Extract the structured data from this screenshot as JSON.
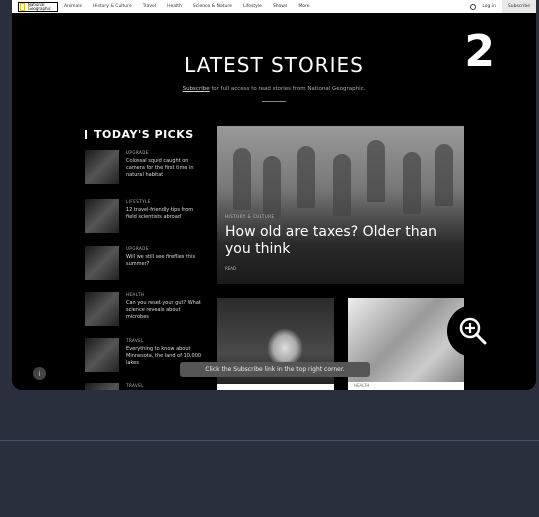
{
  "nav": {
    "logo_text": "National Geographic",
    "links": [
      "Animals",
      "History & Culture",
      "Travel",
      "Health",
      "Science & Nature",
      "Lifestyle",
      "Shows",
      "More"
    ],
    "login": "Log in",
    "subscribe": "Subscribe"
  },
  "step_number": "2",
  "section": {
    "title": "LATEST STORIES",
    "subtitle_link": "Subscribe",
    "subtitle_rest": " for full access to read stories from National Geographic."
  },
  "picks": {
    "title": "TODAY'S PICKS",
    "items": [
      {
        "category": "UPGRADE",
        "title": "Colossal squid caught on camera for the first time in natural habitat"
      },
      {
        "category": "LIFESTYLE",
        "title": "12 travel-friendly tips from field scientists abroad"
      },
      {
        "category": "UPGRADE",
        "title": "Will we still see fireflies this summer?"
      },
      {
        "category": "HEALTH",
        "title": "Can you reset your gut? What science reveals about microbes"
      },
      {
        "category": "TRAVEL",
        "title": "Everything to know about Minnesota, the land of 10,000 lakes"
      },
      {
        "category": "TRAVEL",
        "title": ""
      }
    ]
  },
  "hero": {
    "category": "HISTORY & CULTURE",
    "title": "How old are taxes? Older than you think",
    "read_label": "READ"
  },
  "card2": {
    "category": "HEALTH"
  },
  "help_icon": "i",
  "tooltip": "Click the Subscribe link in the top right corner.",
  "icons": {
    "zoom": "zoom-in-icon",
    "search": "search-icon",
    "help": "info-icon"
  }
}
